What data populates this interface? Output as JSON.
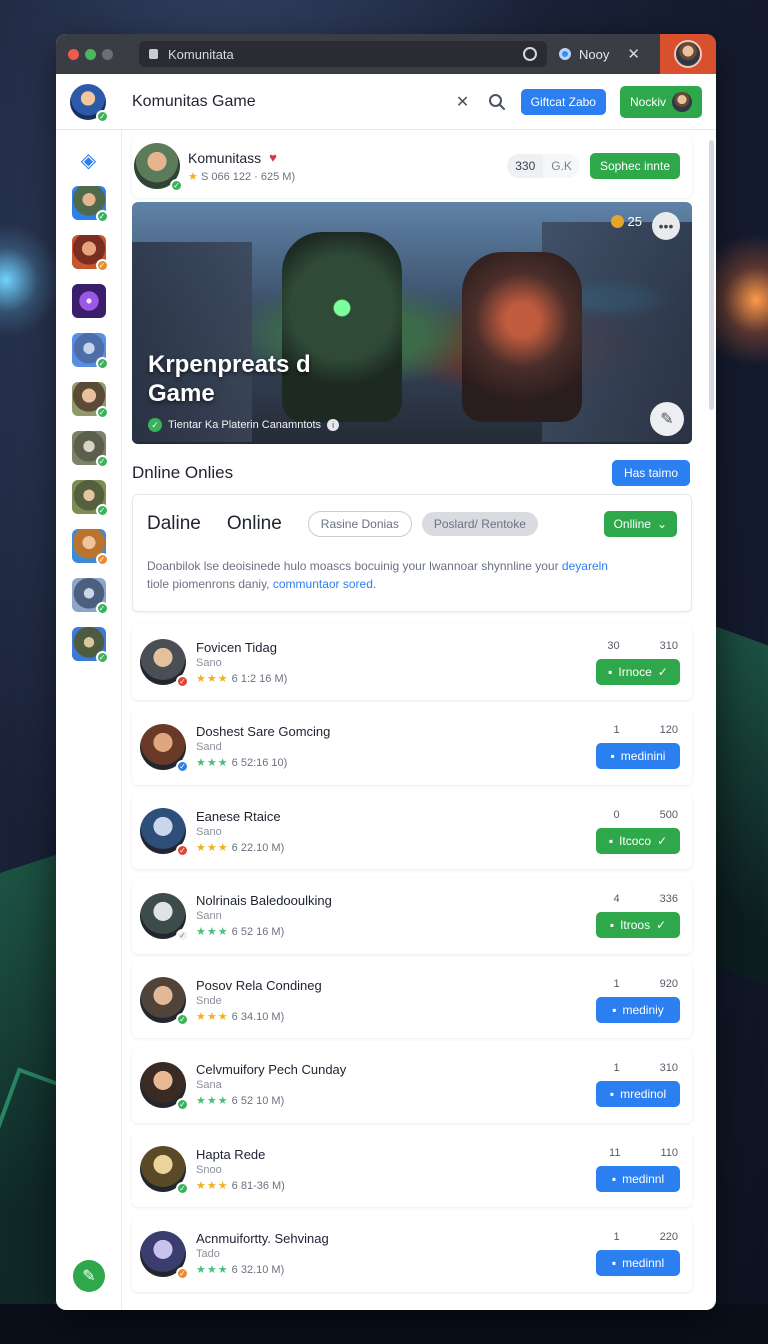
{
  "browser": {
    "url": "Komunitata",
    "tab_label": "Nooy"
  },
  "header": {
    "title": "Komunitas Game",
    "primary_button": "Giftcat Zabo",
    "secondary_button": "Nockiv"
  },
  "community": {
    "name": "Komunitass",
    "meta": "S 066 122 · 625 M)",
    "count_a": "330",
    "count_b": "G.K",
    "action": "Sophec innte"
  },
  "hero": {
    "title": "Krpenpreats d Game",
    "subtitle": "Tientar Ka Platerin Canamntots",
    "coins": "25"
  },
  "section": {
    "title": "Dnline Onlies",
    "button": "Has taimo"
  },
  "filters": {
    "tab1": "Daline",
    "tab2": "Online",
    "chip1": "Rasine Donias",
    "chip2": "Poslard/ Rentoke",
    "dropdown": "Onlline",
    "desc_main": "Doanbilok lse deoisinede hulo moascs bocuinig your lwannoar shynnline your ",
    "desc_link1": "deyareln",
    "desc_line2": "tiole piomenrons daniy, ",
    "desc_link2": "communtaor sored."
  },
  "rows": [
    {
      "name": "Fovicen Tidag",
      "sub": "Sano",
      "meta": "6 1:2 16 M)",
      "n1": "30",
      "n2": "310",
      "btn": "Irnoce",
      "btn_color": "green"
    },
    {
      "name": "Doshest Sare Gomcing",
      "sub": "Sand",
      "meta": "6 52:16 10)",
      "n1": "1",
      "n2": "120",
      "btn": "medinini",
      "btn_color": "blue"
    },
    {
      "name": "Eanese Rtaice",
      "sub": "Sano",
      "meta": "6 22.10 M)",
      "n1": "0",
      "n2": "500",
      "btn": "Itcoco",
      "btn_color": "green"
    },
    {
      "name": "Nolrinais Baledooulking",
      "sub": "Sann",
      "meta": "6 52 16 M)",
      "n1": "4",
      "n2": "336",
      "btn": "Itroos",
      "btn_color": "green"
    },
    {
      "name": "Posov Rela Condineg",
      "sub": "Snde",
      "meta": "6 34.10 M)",
      "n1": "1",
      "n2": "920",
      "btn": "mediniy",
      "btn_color": "blue"
    },
    {
      "name": "Celvmuifory Pech Cunday",
      "sub": "Sana",
      "meta": "6 52 10 M)",
      "n1": "1",
      "n2": "310",
      "btn": "mredinol",
      "btn_color": "blue"
    },
    {
      "name": "Hapta Rede",
      "sub": "Snoo",
      "meta": "6 81-36 M)",
      "n1": "11",
      "n2": "110",
      "btn": "medinnl",
      "btn_color": "blue"
    },
    {
      "name": "Acnmuifortty. Sehvinag",
      "sub": "Tado",
      "meta": "6 32.10 M)",
      "n1": "1",
      "n2": "220",
      "btn": "medinnl",
      "btn_color": "blue"
    }
  ],
  "colors": {
    "accent_blue": "#2c7ff0",
    "accent_green": "#2fa84b",
    "titlebar": "#3a3d44"
  }
}
